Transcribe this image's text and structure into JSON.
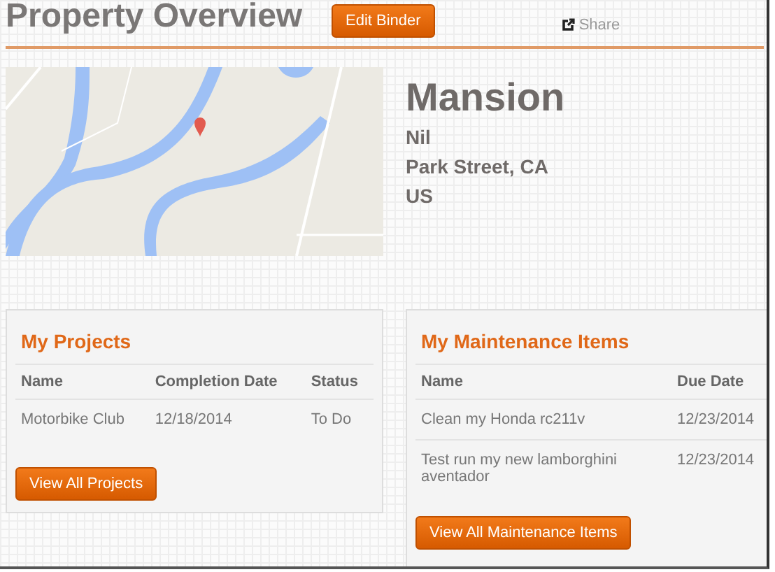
{
  "header": {
    "title": "Property Overview",
    "edit_button": "Edit Binder",
    "share": "Share"
  },
  "property": {
    "name": "Mansion",
    "lines": [
      "Nil",
      "Park Street, CA",
      "US"
    ]
  },
  "projects": {
    "title": "My Projects",
    "columns": [
      "Name",
      "Completion Date",
      "Status"
    ],
    "rows": [
      [
        "Motorbike Club",
        "12/18/2014",
        "To Do"
      ]
    ],
    "button": "View All Projects"
  },
  "maintenance": {
    "title": "My Maintenance Items",
    "columns": [
      "Name",
      "Due Date"
    ],
    "rows": [
      [
        "Clean my Honda rc211v",
        "12/23/2014"
      ],
      [
        "Test run my new lamborghini aventador",
        "12/23/2014"
      ]
    ],
    "button": "View All Maintenance Items"
  }
}
